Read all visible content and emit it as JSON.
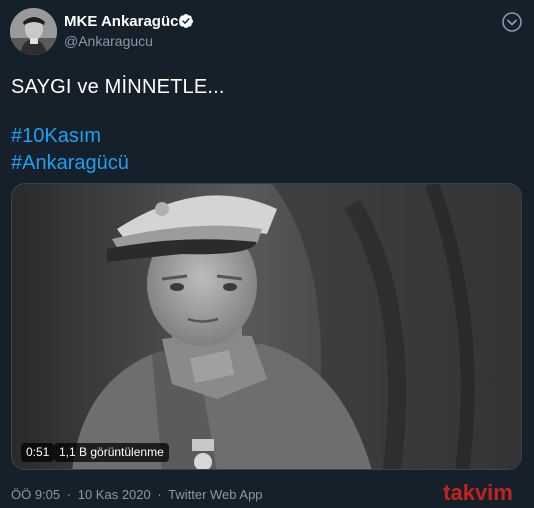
{
  "account": {
    "display_name": "MKE Ankaragücü",
    "handle": "@Ankaragucu",
    "verified": true,
    "avatar_icon": "portrait-avatar-icon"
  },
  "tweet": {
    "text": "SAYGI ve MİNNETLE...",
    "hashtags": [
      "#10Kasım",
      "#Ankaragücü"
    ]
  },
  "media": {
    "type": "video",
    "duration": "0:51",
    "views": "1,1 B görüntülenme"
  },
  "meta": {
    "time": "ÖÖ 9:05",
    "date": "10 Kas 2020",
    "source": "Twitter Web App",
    "separator": "·"
  },
  "watermark": {
    "text": "takvim"
  },
  "colors": {
    "background": "#15202b",
    "link": "#1da1f2",
    "secondary_text": "#8899a6",
    "watermark_red": "#e2231a"
  }
}
